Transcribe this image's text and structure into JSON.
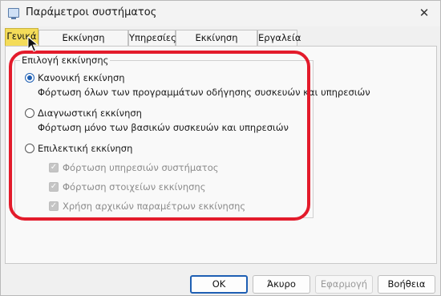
{
  "window": {
    "title": "Παράμετροι συστήματος",
    "close_glyph": "✕"
  },
  "tabs": [
    {
      "label": "Γενικά",
      "active": true
    },
    {
      "label": "Εκκίνηση υπολογιστή",
      "active": false
    },
    {
      "label": "Υπηρεσίες",
      "active": false
    },
    {
      "label": "Εκκίνηση στοιχείων",
      "active": false
    },
    {
      "label": "Εργαλεία",
      "active": false
    }
  ],
  "startup_group": {
    "legend": "Επιλογή εκκίνησης",
    "options": [
      {
        "label": "Κανονική εκκίνηση",
        "description": "Φόρτωση όλων των προγραμμάτων οδήγησης συσκευών και υπηρεσιών",
        "selected": true
      },
      {
        "label": "Διαγνωστική εκκίνηση",
        "description": "Φόρτωση μόνο των βασικών συσκευών και υπηρεσιών",
        "selected": false
      },
      {
        "label": "Επιλεκτική εκκίνηση",
        "description": "",
        "selected": false
      }
    ],
    "selective_checkboxes": [
      {
        "label": "Φόρτωση υπηρεσιών συστήματος",
        "checked": true,
        "disabled": true
      },
      {
        "label": "Φόρτωση στοιχείων εκκίνησης",
        "checked": true,
        "disabled": true
      },
      {
        "label": "Χρήση αρχικών παραμέτρων εκκίνησης",
        "checked": true,
        "disabled": true
      }
    ]
  },
  "buttons": {
    "ok": "OK",
    "cancel": "Άκυρο",
    "apply": "Εφαρμογή",
    "help": "Βοήθεια"
  },
  "colors": {
    "highlight_ring": "#e31b2b",
    "active_tab": "#f4dc59",
    "accent": "#1e5fb3"
  },
  "icons": {
    "checkmark": "✓"
  }
}
